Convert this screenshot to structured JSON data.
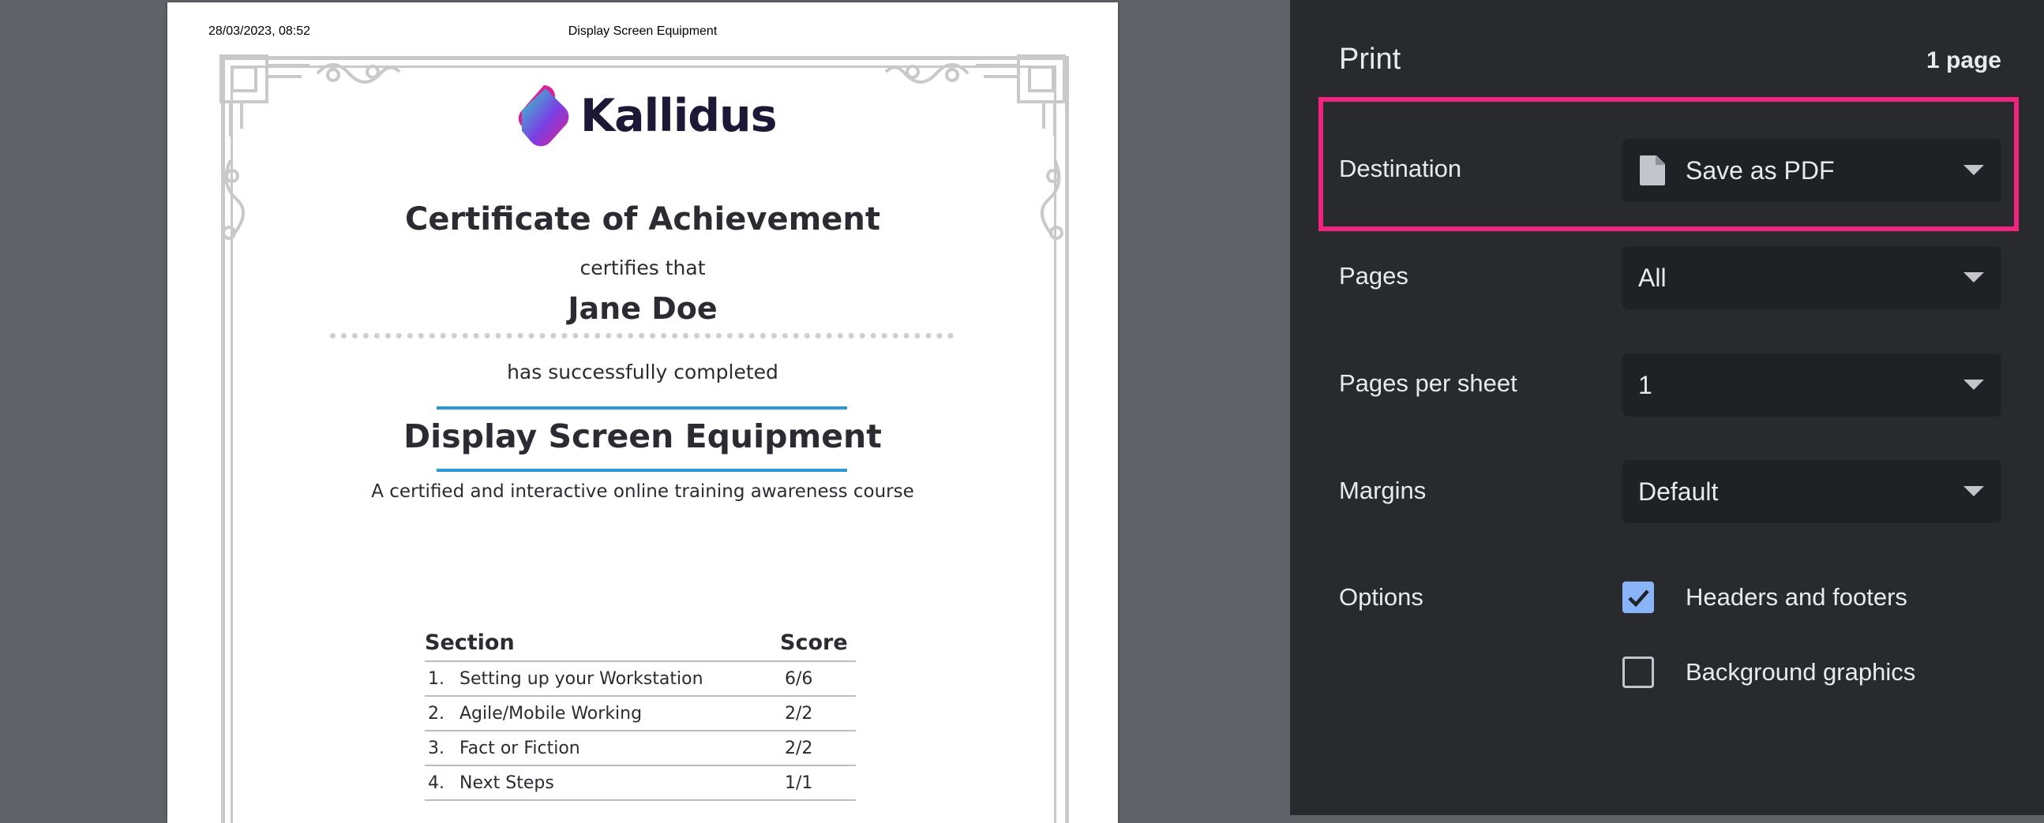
{
  "preview": {
    "header_date": "28/03/2023, 08:52",
    "header_title": "Display Screen Equipment",
    "logo_text": "Kallidus",
    "certificate": {
      "title": "Certificate of Achievement",
      "certifies": "certifies that",
      "recipient": "Jane Doe",
      "completed": "has successfully completed",
      "course_name": "Display Screen Equipment",
      "course_desc": "A certified and interactive online training awareness course"
    },
    "scores": {
      "headers": {
        "section": "Section",
        "score": "Score"
      },
      "rows": [
        {
          "num": "1.",
          "name": "Setting up your Workstation",
          "score": "6/6"
        },
        {
          "num": "2.",
          "name": "Agile/Mobile Working",
          "score": "2/2"
        },
        {
          "num": "3.",
          "name": "Fact or Fiction",
          "score": "2/2"
        },
        {
          "num": "4.",
          "name": "Next Steps",
          "score": "1/1"
        }
      ]
    }
  },
  "panel": {
    "title": "Print",
    "page_count": "1 page",
    "destination": {
      "label": "Destination",
      "value": "Save as PDF",
      "icon": "file-icon"
    },
    "pages": {
      "label": "Pages",
      "value": "All"
    },
    "pages_per_sheet": {
      "label": "Pages per sheet",
      "value": "1"
    },
    "margins": {
      "label": "Margins",
      "value": "Default"
    },
    "options": {
      "label": "Options",
      "headers_footers": {
        "label": "Headers and footers",
        "checked": true
      },
      "background_graphics": {
        "label": "Background graphics",
        "checked": false
      }
    }
  },
  "colors": {
    "panel_bg": "#292a2d",
    "select_bg": "#202124",
    "checkbox_accent": "#8ab4f8",
    "highlight": "#f2237f",
    "course_rule": "#2a9ad6",
    "logo_gradient": [
      "#2fd3c5",
      "#e11d8f",
      "#7b3fe4"
    ]
  }
}
